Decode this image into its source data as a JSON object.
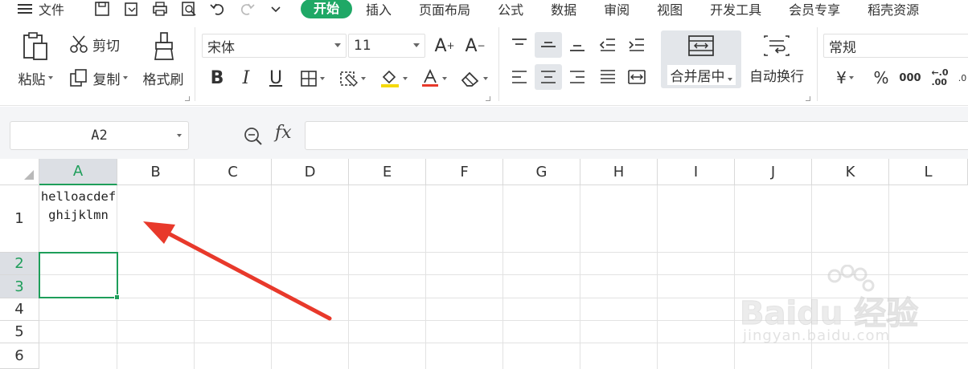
{
  "menubar": {
    "file_label": "文件",
    "start_tab": "开始",
    "tabs": [
      "插入",
      "页面布局",
      "公式",
      "数据",
      "审阅",
      "视图",
      "开发工具",
      "会员专享",
      "稻壳资源"
    ]
  },
  "ribbon": {
    "paste_label": "粘贴",
    "cut_label": "剪切",
    "copy_label": "复制",
    "format_painter_label": "格式刷",
    "font_name": "宋体",
    "font_size": "11",
    "bold_glyph": "B",
    "italic_glyph": "I",
    "underline_glyph": "U",
    "merge_center_label": "合并居中",
    "wrap_text_label": "自动换行",
    "number_format": "常规",
    "currency_glyph": "¥",
    "percent_glyph": "%",
    "thousands_glyph": "000",
    "decimal_glyph": "←.0\n.00"
  },
  "formula_bar": {
    "cell_ref": "A2",
    "fx_label": "fx",
    "formula_value": ""
  },
  "grid": {
    "columns": [
      "A",
      "B",
      "C",
      "D",
      "E",
      "F",
      "G",
      "H",
      "I",
      "J",
      "K",
      "L"
    ],
    "rows": [
      "1",
      "2",
      "3",
      "4",
      "5",
      "6"
    ],
    "cell_a1": "helloacdefghijklmn",
    "selected_column": "A",
    "selected_rows": [
      "2",
      "3"
    ]
  },
  "colors": {
    "accent": "#1fa866",
    "selection": "#1e9e5a",
    "arrow": "#e8392b"
  },
  "watermark": {
    "brand": "Baidu 经验",
    "url": "jingyan.baidu.com"
  }
}
